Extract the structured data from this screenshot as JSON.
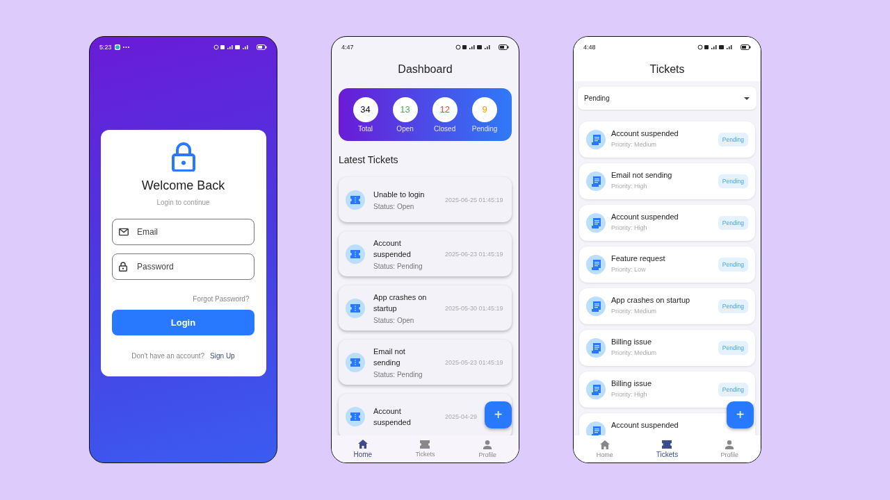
{
  "login_screen": {
    "status_bar": {
      "time": "5:23"
    },
    "title": "Welcome Back",
    "subtitle": "Login to continue",
    "fields": [
      {
        "kind": "email",
        "placeholder": "Email"
      },
      {
        "kind": "password",
        "placeholder": "Password"
      }
    ],
    "forgot_link": "Forgot Password?",
    "login_button": "Login",
    "signup_prompt": "Don't have an account?",
    "signup_link": "Sign Up"
  },
  "dashboard_screen": {
    "status_bar": {
      "time": "4:47"
    },
    "title": "Dashboard",
    "stats": [
      {
        "value": "34",
        "label": "Total",
        "color": "#111111"
      },
      {
        "value": "13",
        "label": "Open",
        "color": "#4caf50"
      },
      {
        "value": "12",
        "label": "Closed",
        "color": "#f44336"
      },
      {
        "value": "9",
        "label": "Pending",
        "color": "#ff9800"
      }
    ],
    "section_title": "Latest Tickets",
    "tickets": [
      {
        "title": "Unable to login",
        "status": "Status: Open",
        "date": "2025-06-25 01:45:19"
      },
      {
        "title": "Account suspended",
        "status": "Status: Pending",
        "date": "2025-06-23 01:45:19"
      },
      {
        "title": "App crashes on startup",
        "status": "Status: Open",
        "date": "2025-05-30 01:45:19"
      },
      {
        "title": "Email not sending",
        "status": "Status: Pending",
        "date": "2025-05-23 01:45:19"
      },
      {
        "title": "Account suspended",
        "date": "2025-04-29"
      }
    ],
    "fab": "+",
    "nav": [
      {
        "label": "Home",
        "kind": "home",
        "selected": true
      },
      {
        "label": "Tickets",
        "kind": "tickets",
        "selected": false
      },
      {
        "label": "Profile",
        "kind": "profile",
        "selected": false
      }
    ]
  },
  "tickets_screen": {
    "status_bar": {
      "time": "4:48"
    },
    "title": "Tickets",
    "filter": "Pending",
    "tickets": [
      {
        "title": "Account suspended",
        "priority": "Priority: Medium",
        "badge": "Pending"
      },
      {
        "title": "Email not sending",
        "priority": "Priority: High",
        "badge": "Pending"
      },
      {
        "title": "Account suspended",
        "priority": "Priority: High",
        "badge": "Pending"
      },
      {
        "title": "Feature request",
        "priority": "Priority: Low",
        "badge": "Pending"
      },
      {
        "title": "App crashes on startup",
        "priority": "Priority: Medium",
        "badge": "Pending"
      },
      {
        "title": "Billing issue",
        "priority": "Priority: Medium",
        "badge": "Pending"
      },
      {
        "title": "Billing issue",
        "priority": "Priority: High",
        "badge": "Pending"
      },
      {
        "title": "Account suspended"
      }
    ],
    "fab": "+",
    "nav": [
      {
        "label": "Home",
        "kind": "home",
        "selected": false
      },
      {
        "label": "Tickets",
        "kind": "tickets",
        "selected": true
      },
      {
        "label": "Profile",
        "kind": "profile",
        "selected": false
      }
    ]
  }
}
